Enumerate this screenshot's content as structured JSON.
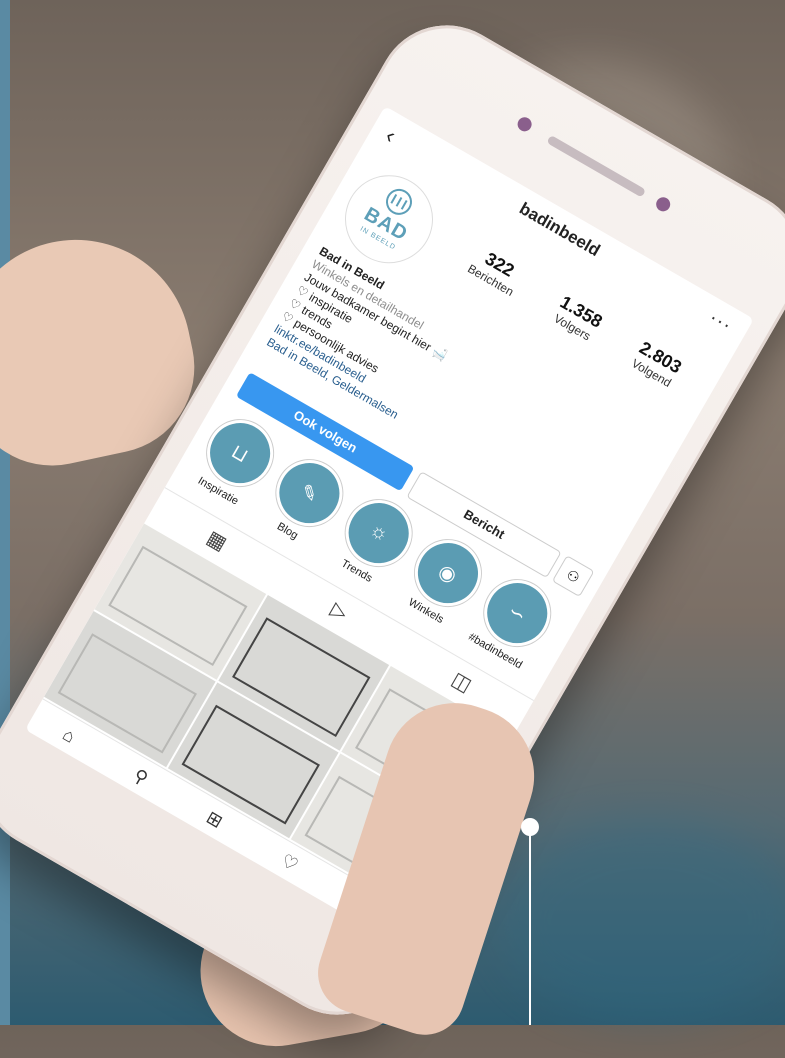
{
  "profile": {
    "username": "badinbeeld",
    "logo_text": "BAD",
    "logo_sub": "IN BEELD",
    "stats": [
      {
        "value": "322",
        "label": "Berichten"
      },
      {
        "value": "1.358",
        "label": "Volgers"
      },
      {
        "value": "2.803",
        "label": "Volgend"
      }
    ],
    "bio": {
      "name": "Bad in Beeld",
      "category": "Winkels en detailhandel",
      "line1": "Jouw badkamer begint hier 🛁",
      "line2": "♡ inspiratie",
      "line3": "♡ trends",
      "line4": "♡ persoonlijk advies",
      "link": "linktr.ee/badinbeeld",
      "location": "Bad in Beeld, Geldermalsen"
    },
    "buttons": {
      "follow": "Ook volgen",
      "message": "Bericht",
      "suggest_icon": "add-person-icon"
    },
    "highlights": [
      {
        "label": "Inspiratie",
        "icon": "bathtub-icon"
      },
      {
        "label": "Blog",
        "icon": "pencil-icon"
      },
      {
        "label": "Trends",
        "icon": "lightbulb-icon"
      },
      {
        "label": "Winkels",
        "icon": "location-pin-icon"
      },
      {
        "label": "#badinbeeld",
        "icon": "signature-icon"
      }
    ],
    "tabs": [
      "grid-icon",
      "reels-icon",
      "tagged-icon"
    ],
    "bottom_nav": [
      "home-icon",
      "search-icon",
      "add-icon",
      "activity-icon",
      "profile-icon"
    ]
  },
  "colors": {
    "accent": "#5b9cb3",
    "follow_button": "#3897f0",
    "phone_body": "#f2ebe7"
  }
}
